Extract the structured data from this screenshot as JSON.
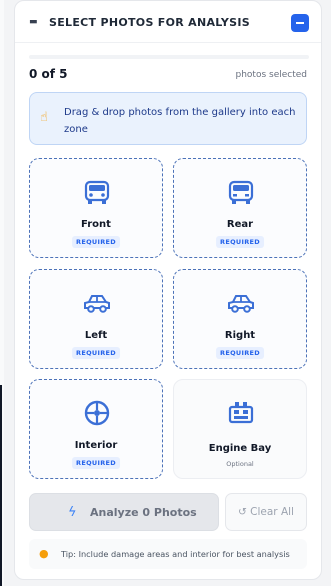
{
  "header": {
    "icon": "camera-icon",
    "title": "SELECT PHOTOS FOR ANALYSIS",
    "collapse_icon": "minus-icon"
  },
  "progress": {
    "count_label": "0 of 5",
    "selected_label": "photos selected",
    "fraction": 0
  },
  "hint": {
    "icon": "pointing-hand-icon",
    "text": "Drag & drop photos from the gallery into each zone"
  },
  "zones": [
    {
      "name": "Front",
      "badge": "REQUIRED",
      "icon": "car-front-icon"
    },
    {
      "name": "Rear",
      "badge": "REQUIRED",
      "icon": "car-rear-icon"
    },
    {
      "name": "Left",
      "badge": "REQUIRED",
      "icon": "car-side-icon"
    },
    {
      "name": "Right",
      "badge": "REQUIRED",
      "icon": "car-side-icon"
    },
    {
      "name": "Interior",
      "badge": "REQUIRED",
      "icon": "steering-wheel-icon"
    },
    {
      "name": "Engine Bay",
      "badge": "Optional",
      "icon": "engine-icon"
    }
  ],
  "actions": {
    "analyze_label": "Analyze 0 Photos",
    "analyze_icon": "lightning-icon",
    "clear_label": "↺ Clear All"
  },
  "tip": {
    "icon": "lightbulb-icon",
    "text": "Tip: Include damage areas and interior for best analysis"
  },
  "colors": {
    "accent": "#2563eb",
    "icon_blue": "#3b6fd6",
    "dashed_border": "#4c72b8",
    "hint_bg": "#eaf2fd"
  }
}
